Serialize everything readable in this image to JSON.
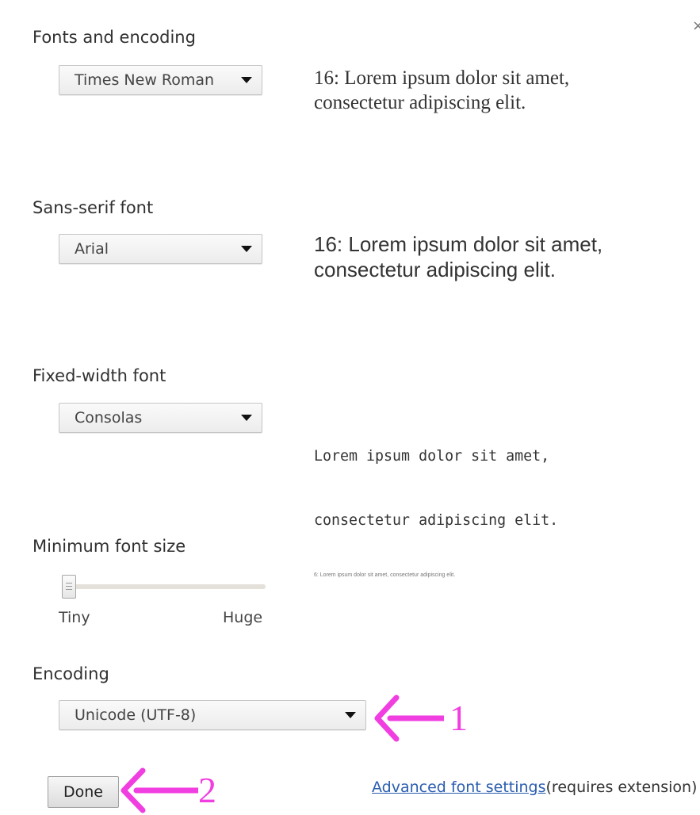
{
  "section_title": "Fonts and encoding",
  "close_glyph": "×",
  "standard_font": {
    "selected": "Times New Roman",
    "preview": [
      "16: Lorem ipsum dolor sit amet,",
      "consectetur adipiscing elit."
    ]
  },
  "sans_serif_font": {
    "label": "Sans-serif font",
    "selected": "Arial",
    "preview": [
      "16: Lorem ipsum dolor sit amet,",
      "consectetur adipiscing elit."
    ]
  },
  "fixed_width_font": {
    "label": "Fixed-width font",
    "selected": "Consolas",
    "preview": [
      "Lorem ipsum dolor sit amet,",
      "consectetur adipiscing elit."
    ]
  },
  "minimum_font_size": {
    "label": "Minimum font size",
    "min_label": "Tiny",
    "max_label": "Huge",
    "slider_level": 0,
    "preview": "6: Lorem ipsum dolor sit amet, consectetur adipiscing elit."
  },
  "encoding": {
    "label": "Encoding",
    "selected": "Unicode (UTF-8)"
  },
  "footer": {
    "done_label": "Done",
    "advanced_link": "Advanced font settings",
    "advanced_note": "(requires extension)"
  },
  "annotations": {
    "callout_1": "1",
    "callout_2": "2",
    "color": "#f03ee0"
  },
  "colors": {
    "link": "#2a5db0",
    "heading": "#303030"
  }
}
